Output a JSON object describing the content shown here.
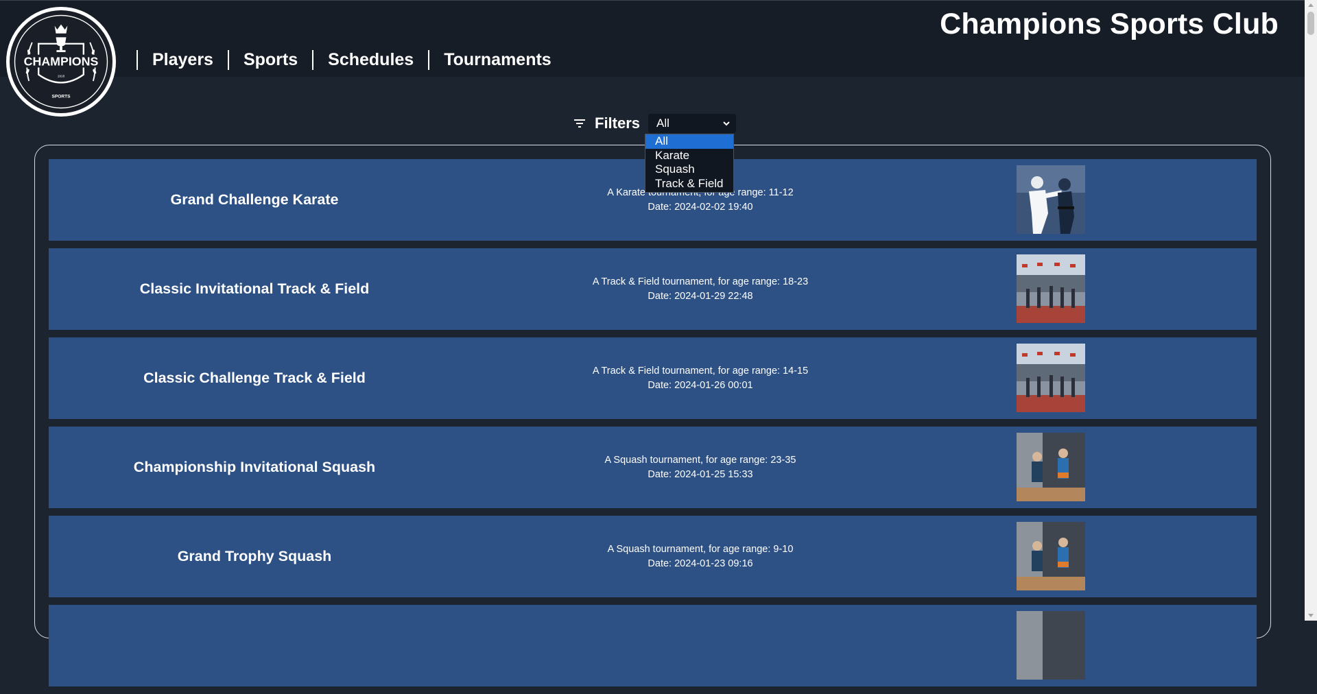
{
  "header": {
    "site_title": "Champions Sports Club",
    "logo": {
      "text": "CHAMPIONS",
      "subtext": "SPORTS",
      "year": "1918",
      "icon": "trophy-crest-icon"
    },
    "nav": [
      {
        "label": "Players"
      },
      {
        "label": "Sports"
      },
      {
        "label": "Schedules"
      },
      {
        "label": "Tournaments"
      }
    ]
  },
  "filters": {
    "label": "Filters",
    "icon": "filter-icon",
    "selected": "All",
    "options": [
      "All",
      "Karate",
      "Squash",
      "Track & Field"
    ],
    "open": true
  },
  "tournaments": [
    {
      "title": "Grand Challenge Karate",
      "description": "A Karate tournament, for age range: 11-12",
      "date": "Date: 2024-02-02 19:40",
      "image": "karate-image"
    },
    {
      "title": "Classic Invitational Track & Field",
      "description": "A Track & Field tournament, for age range: 18-23",
      "date": "Date: 2024-01-29 22:48",
      "image": "track-field-image"
    },
    {
      "title": "Classic Challenge Track & Field",
      "description": "A Track & Field tournament, for age range: 14-15",
      "date": "Date: 2024-01-26 00:01",
      "image": "track-field-image"
    },
    {
      "title": "Championship Invitational Squash",
      "description": "A Squash tournament, for age range: 23-35",
      "date": "Date: 2024-01-25 15:33",
      "image": "squash-image"
    },
    {
      "title": "Grand Trophy Squash",
      "description": "A Squash tournament, for age range: 9-10",
      "date": "Date: 2024-01-23 09:16",
      "image": "squash-image"
    }
  ],
  "colors": {
    "page_bg": "#1c2430",
    "header_bg": "#161d26",
    "card_bg": "#2d5185",
    "select_bg": "#111720",
    "option_highlight": "#1f6ed4"
  }
}
